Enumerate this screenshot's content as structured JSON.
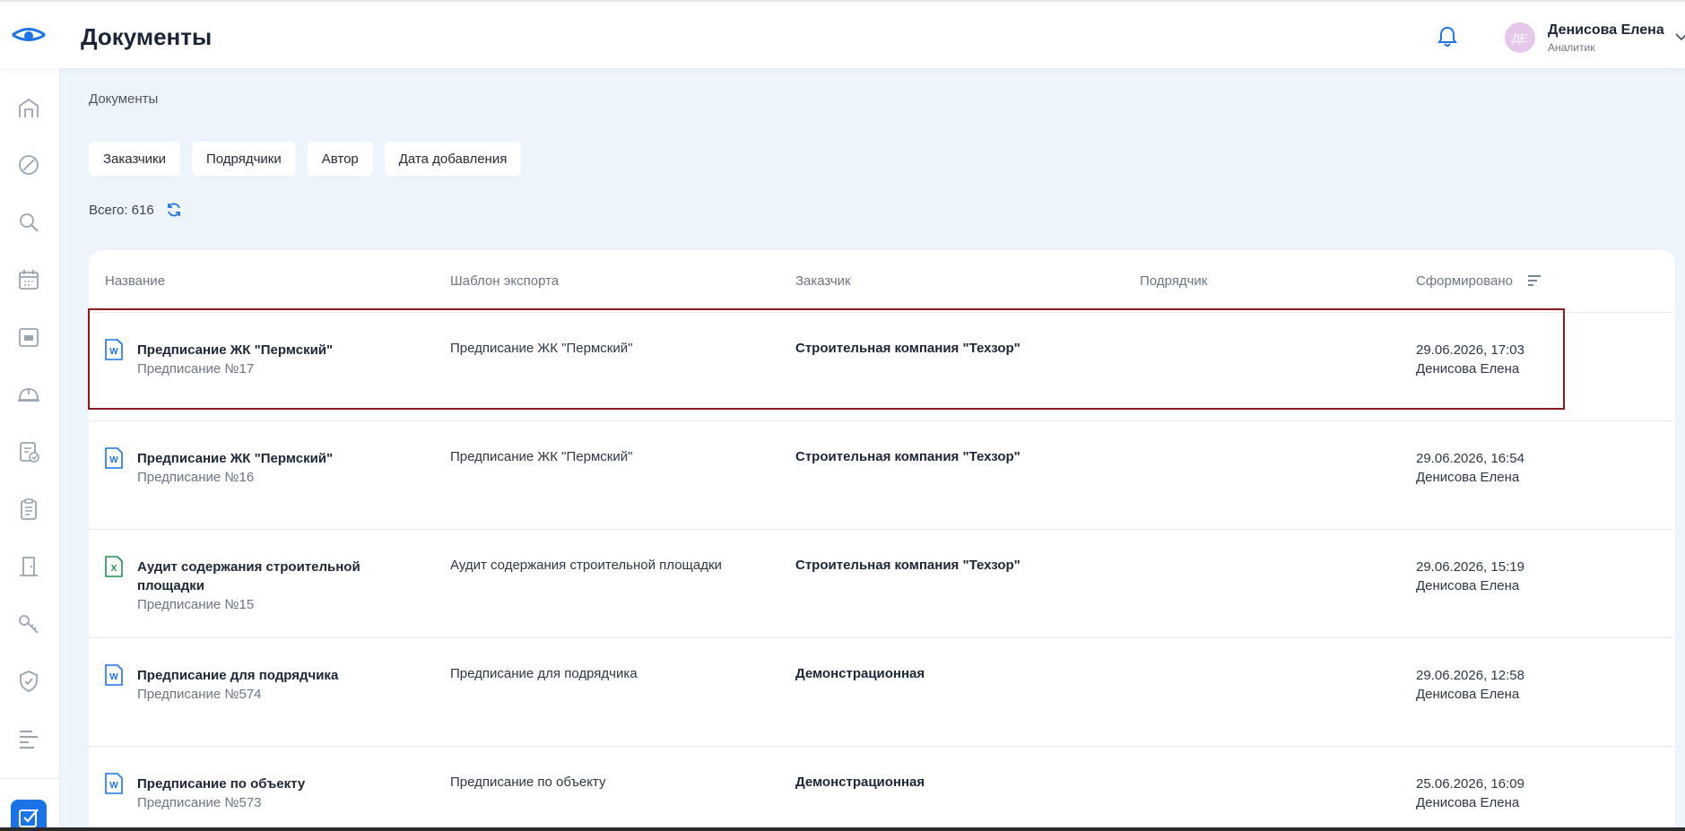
{
  "header": {
    "title": "Документы",
    "user": {
      "initials": "ДЕ",
      "name": "Денисова Елена",
      "role": "Аналитик"
    }
  },
  "sidebar": {
    "items": [
      {
        "icon": "building-icon"
      },
      {
        "icon": "block-icon"
      },
      {
        "icon": "search-icon"
      },
      {
        "icon": "calendar-icon"
      },
      {
        "icon": "folder-icon"
      },
      {
        "icon": "helmet-icon"
      },
      {
        "icon": "checklist-clock-icon"
      },
      {
        "icon": "clipboard-icon"
      },
      {
        "icon": "door-icon"
      },
      {
        "icon": "key-icon"
      },
      {
        "icon": "shield-check-icon"
      },
      {
        "icon": "gantt-icon"
      },
      {
        "icon": "checkbox-icon",
        "active": true
      }
    ]
  },
  "breadcrumb": "Документы",
  "filters": [
    "Заказчики",
    "Подрядчики",
    "Автор",
    "Дата добавления"
  ],
  "total_label": "Всего: 616",
  "table": {
    "columns": [
      "Название",
      "Шаблон экспорта",
      "Заказчик",
      "Подрядчик",
      "Сформировано"
    ],
    "rows": [
      {
        "type": "word",
        "title": "Предписание ЖК \"Пермский\"",
        "subtitle": "Предписание №17",
        "template": "Предписание ЖК \"Пермский\"",
        "customer": "Строительная компания \"Техзор\"",
        "contractor": "",
        "date": "29.06.2026, 17:03",
        "author": "Денисова Елена"
      },
      {
        "type": "word",
        "title": "Предписание ЖК \"Пермский\"",
        "subtitle": "Предписание №16",
        "template": "Предписание ЖК \"Пермский\"",
        "customer": "Строительная компания \"Техзор\"",
        "contractor": "",
        "date": "29.06.2026, 16:54",
        "author": "Денисова Елена"
      },
      {
        "type": "excel",
        "title": "Аудит содержания строительной площадки",
        "subtitle": "Предписание №15",
        "template": "Аудит содержания строительной площадки",
        "customer": "Строительная компания \"Техзор\"",
        "contractor": "",
        "date": "29.06.2026, 15:19",
        "author": "Денисова Елена"
      },
      {
        "type": "word",
        "title": "Предписание для подрядчика",
        "subtitle": "Предписание №574",
        "template": "Предписание для подрядчика",
        "customer": "Демонстрационная",
        "contractor": "",
        "date": "29.06.2026, 12:58",
        "author": "Денисова Елена"
      },
      {
        "type": "word",
        "title": "Предписание по объекту",
        "subtitle": "Предписание №573",
        "template": "Предписание по объекту",
        "customer": "Демонстрационная",
        "contractor": "",
        "date": "25.06.2026, 16:09",
        "author": "Денисова Елена"
      }
    ]
  },
  "colors": {
    "accent": "#1a73e8",
    "excel": "#1e8e4e",
    "selection": "#8b1a1f"
  }
}
